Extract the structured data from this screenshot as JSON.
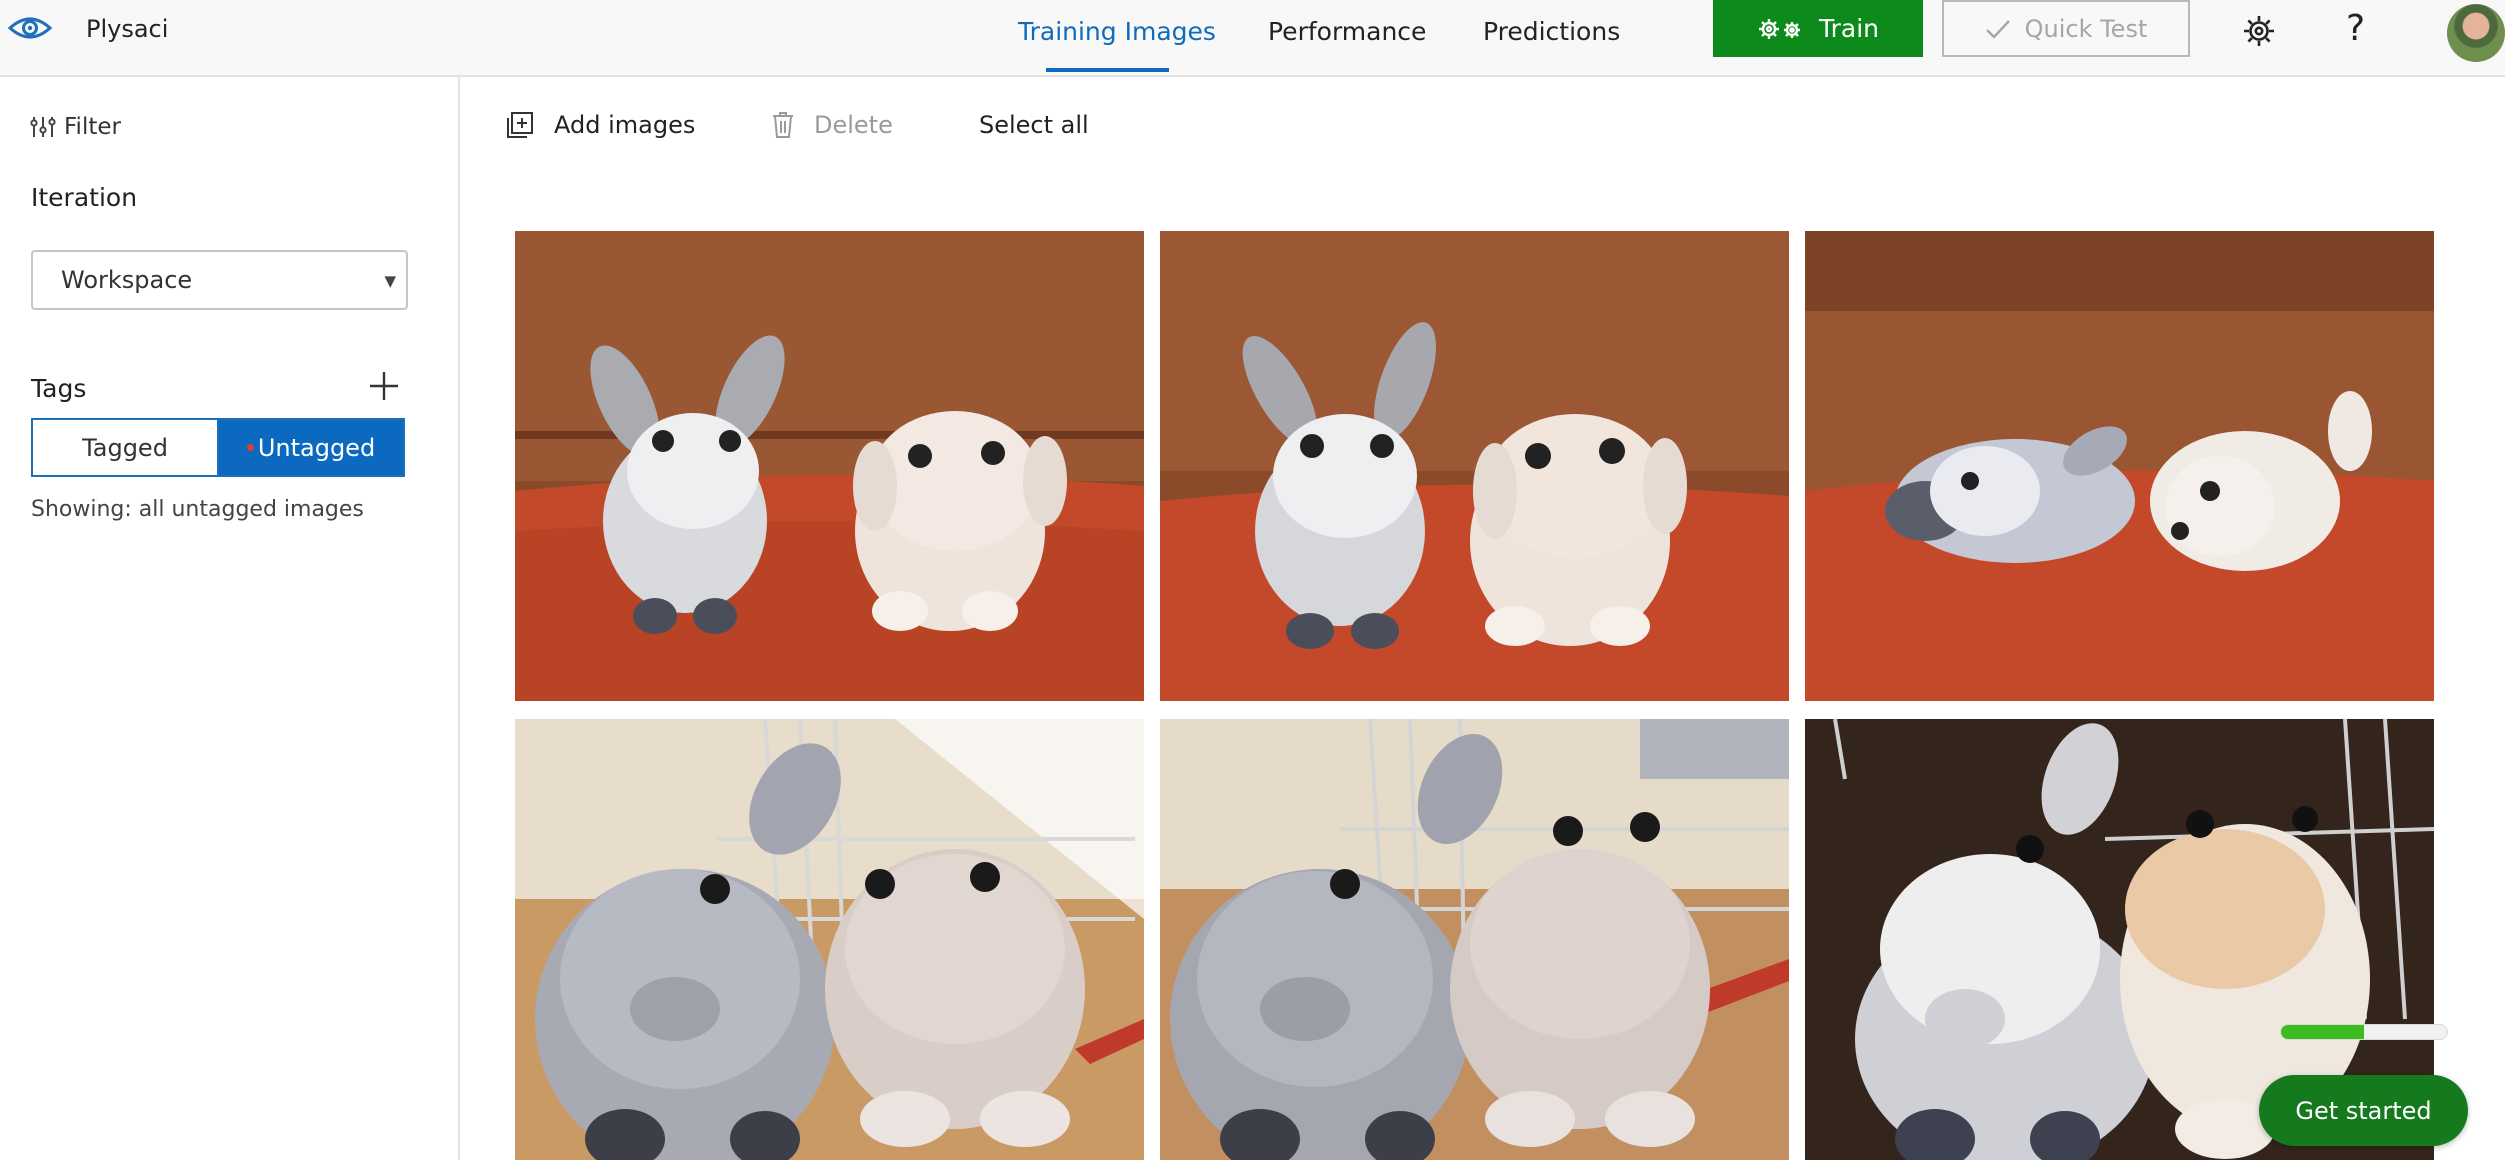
{
  "project": {
    "name": "Plysaci"
  },
  "tabs": [
    {
      "label": "Training Images",
      "active": true
    },
    {
      "label": "Performance",
      "active": false
    },
    {
      "label": "Predictions",
      "active": false
    }
  ],
  "actions": {
    "train_label": "Train",
    "quick_test_label": "Quick Test",
    "quick_test_enabled": false
  },
  "sidebar": {
    "filter_label": "Filter",
    "iteration_label": "Iteration",
    "iteration_value": "Workspace",
    "tags_label": "Tags",
    "toggle": {
      "tagged_label": "Tagged",
      "untagged_label": "Untagged",
      "selected": "Untagged"
    },
    "showing_text": "Showing: all untagged images"
  },
  "toolbar": {
    "add_images_label": "Add images",
    "delete_label": "Delete",
    "delete_enabled": false,
    "select_all_label": "Select all"
  },
  "gallery": {
    "images": [
      {
        "scene": "donkey and sheep plush toys sitting on orange rug against wooden wall"
      },
      {
        "scene": "donkey and sheep plush toys close together on orange rug"
      },
      {
        "scene": "donkey and sheep plush toys lying on orange rug"
      },
      {
        "scene": "grey donkey and sheep plush toys near wire rack on wooden floor, bright"
      },
      {
        "scene": "grey donkey and sheep plush toys near wire rack on wooden floor"
      },
      {
        "scene": "white donkey and sheep plush toys in dark room near wire rack"
      }
    ]
  },
  "onboarding": {
    "get_started_label": "Get started",
    "progress": 0.5
  },
  "colors": {
    "accent": "#0f6cbd",
    "train_green": "#0c8a1c",
    "get_started_green": "#157a1d"
  }
}
